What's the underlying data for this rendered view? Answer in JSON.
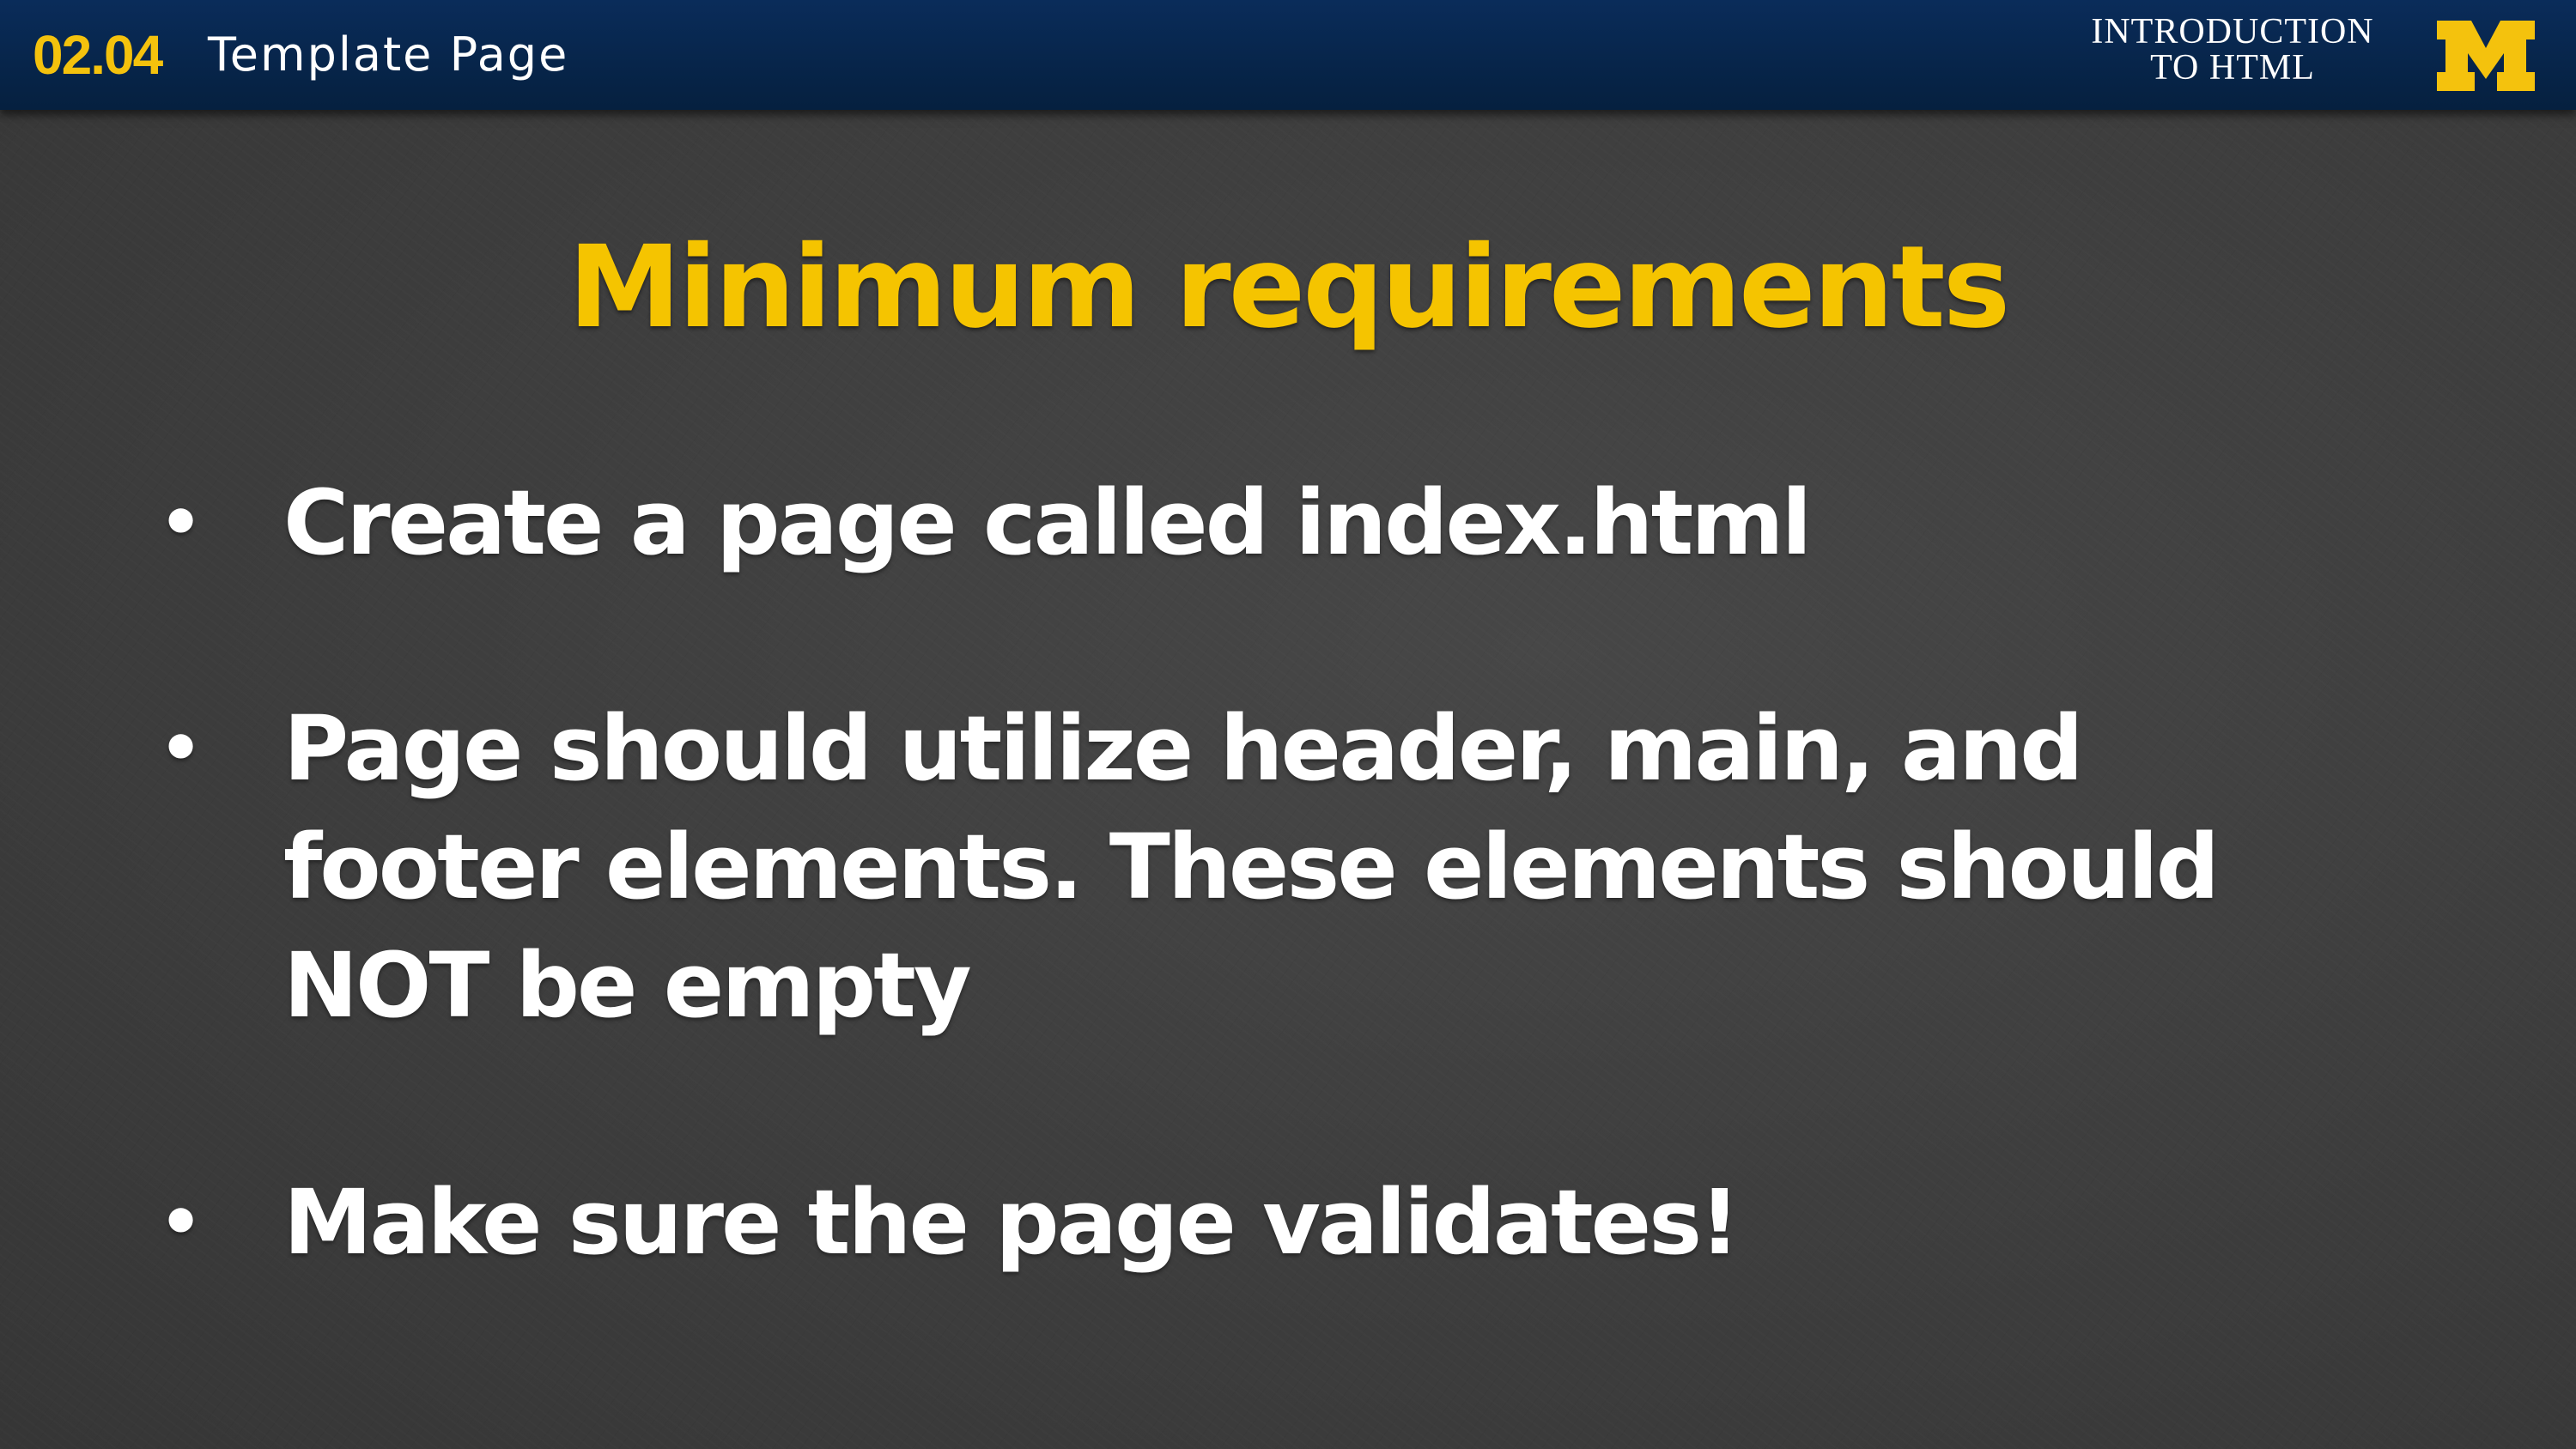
{
  "header": {
    "lesson_number": "02.04",
    "lesson_title": "Template Page",
    "course_line_1": "INTRODUCTION",
    "course_line_2": "TO HTML",
    "logo_icon": "block-m-logo",
    "logo_color": "#f4c20d",
    "bar_color": "#05203f"
  },
  "slide": {
    "title": "Minimum requirements",
    "title_color": "#f5c400",
    "bullets": [
      "Create a page called index.html",
      "Page should utilize header, main, and footer elements.  These elements should NOT be empty",
      "Make sure the page validates!"
    ]
  }
}
